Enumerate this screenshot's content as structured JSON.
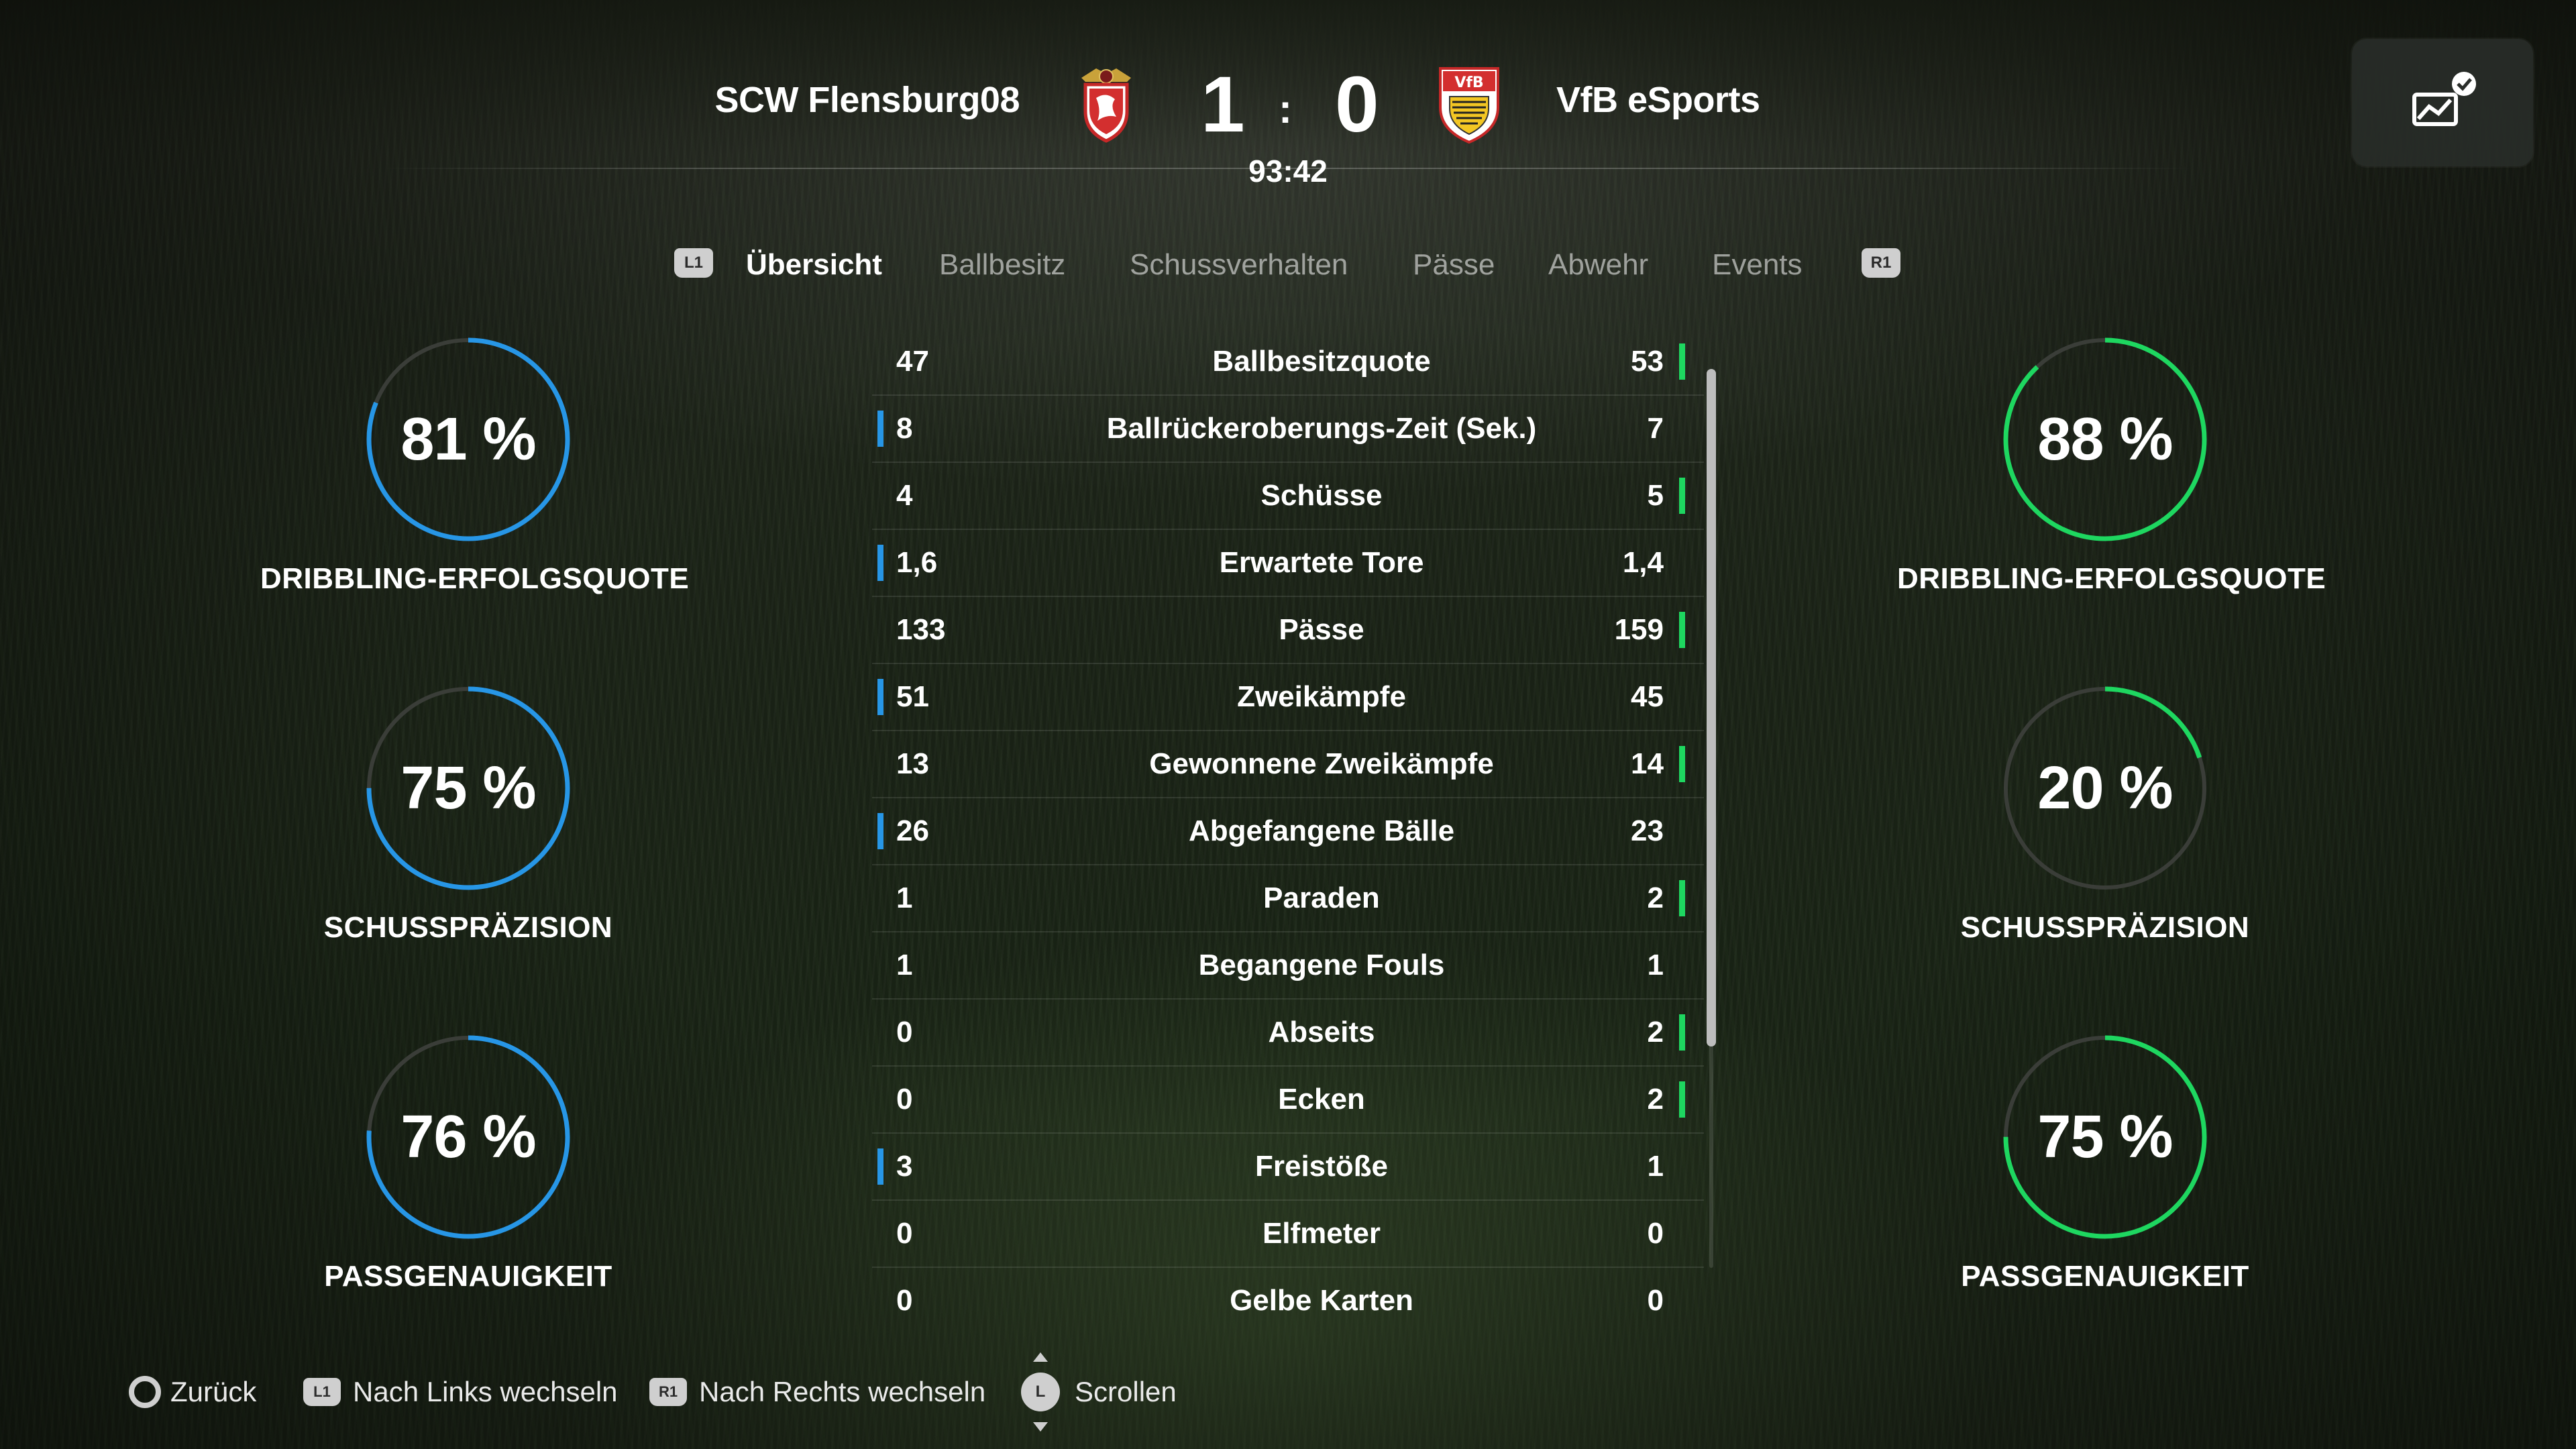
{
  "match": {
    "home_team": "SCW Flensburg08",
    "away_team": "VfB eSports",
    "home_score": "1",
    "away_score": "0",
    "separator": ":",
    "clock": "93:42",
    "home_crest_icon": "scw-flensburg-crest-icon",
    "away_crest_icon": "vfb-stuttgart-crest-icon"
  },
  "corner_button_icon": "stats-chart-check-icon",
  "tabs": {
    "left_bumper": "L1",
    "right_bumper": "R1",
    "items": [
      "Übersicht",
      "Ballbesitz",
      "Schussverhalten",
      "Pässe",
      "Abwehr",
      "Events"
    ],
    "active": "Übersicht"
  },
  "home_gauges": [
    {
      "value": "81 %",
      "label": "DRIBBLING-ERFOLGSQUOTE",
      "fraction": 0.81
    },
    {
      "value": "75 %",
      "label": "SCHUSSPRÄZISION",
      "fraction": 0.75
    },
    {
      "value": "76 %",
      "label": "PASSGENAUIGKEIT",
      "fraction": 0.76
    }
  ],
  "away_gauges": [
    {
      "value": "88 %",
      "label": "DRIBBLING-ERFOLGSQUOTE",
      "fraction": 0.88
    },
    {
      "value": "20 %",
      "label": "SCHUSSPRÄZISION",
      "fraction": 0.2
    },
    {
      "value": "75 %",
      "label": "PASSGENAUIGKEIT",
      "fraction": 0.75
    }
  ],
  "colors": {
    "home": "#2796e6",
    "away": "#1ed760",
    "track": "#3a3d38"
  },
  "stats": [
    {
      "name": "Ballbesitzquote",
      "home": "47",
      "away": "53",
      "leader": "away"
    },
    {
      "name": "Ballrückeroberungs-Zeit (Sek.)",
      "home": "8",
      "away": "7",
      "leader": "home"
    },
    {
      "name": "Schüsse",
      "home": "4",
      "away": "5",
      "leader": "away"
    },
    {
      "name": "Erwartete Tore",
      "home": "1,6",
      "away": "1,4",
      "leader": "home"
    },
    {
      "name": "Pässe",
      "home": "133",
      "away": "159",
      "leader": "away"
    },
    {
      "name": "Zweikämpfe",
      "home": "51",
      "away": "45",
      "leader": "home"
    },
    {
      "name": "Gewonnene Zweikämpfe",
      "home": "13",
      "away": "14",
      "leader": "away"
    },
    {
      "name": "Abgefangene Bälle",
      "home": "26",
      "away": "23",
      "leader": "home"
    },
    {
      "name": "Paraden",
      "home": "1",
      "away": "2",
      "leader": "away"
    },
    {
      "name": "Begangene Fouls",
      "home": "1",
      "away": "1",
      "leader": "none"
    },
    {
      "name": "Abseits",
      "home": "0",
      "away": "2",
      "leader": "away"
    },
    {
      "name": "Ecken",
      "home": "0",
      "away": "2",
      "leader": "away"
    },
    {
      "name": "Freistöße",
      "home": "3",
      "away": "1",
      "leader": "home"
    },
    {
      "name": "Elfmeter",
      "home": "0",
      "away": "0",
      "leader": "none"
    },
    {
      "name": "Gelbe Karten",
      "home": "0",
      "away": "0",
      "leader": "none"
    }
  ],
  "footer": {
    "back": {
      "icon": "circle-button-icon",
      "label": "Zurück"
    },
    "left": {
      "bumper": "L1",
      "label": "Nach Links wechseln"
    },
    "right": {
      "bumper": "R1",
      "label": "Nach Rechts wechseln"
    },
    "scroll": {
      "stick": "L",
      "label": "Scrollen"
    }
  }
}
